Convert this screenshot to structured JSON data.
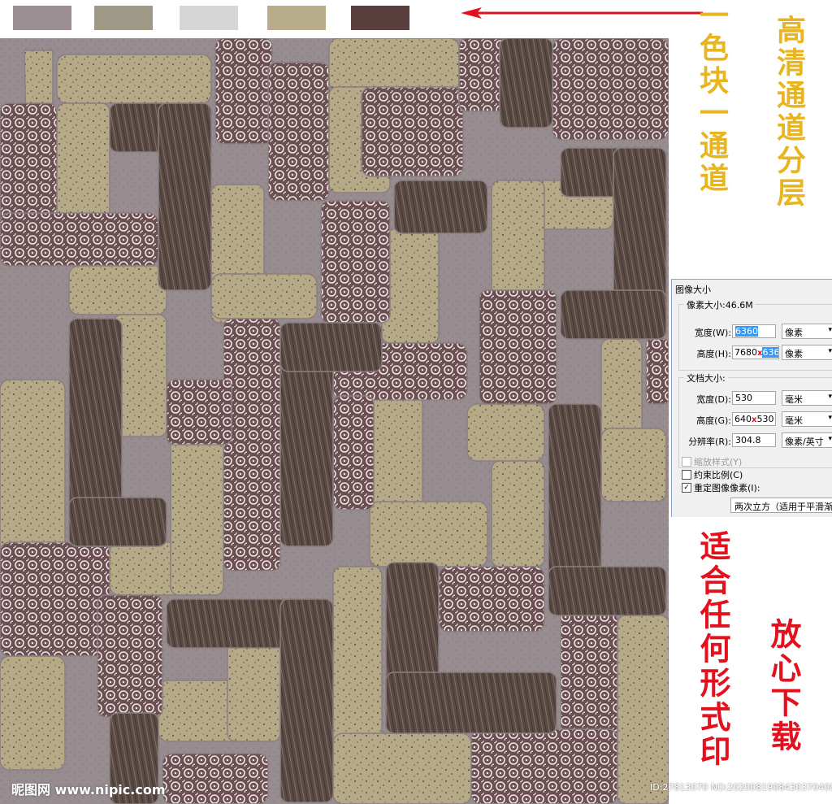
{
  "swatches": [
    {
      "name": "gray-mauve",
      "color": "#9c8f93"
    },
    {
      "name": "olive-gray",
      "color": "#9f9a87"
    },
    {
      "name": "light-gray",
      "color": "#d6d6d6"
    },
    {
      "name": "tan",
      "color": "#b8ad8a"
    },
    {
      "name": "dark-brown",
      "color": "#5b3e3e"
    }
  ],
  "annotations": {
    "channel_note": "一色块一通道",
    "hd_note": "高清通道分层",
    "print_note": "适合任何形式印",
    "download_note": "放心下载"
  },
  "dialog": {
    "title": "图像大小",
    "pixel_size_label": "像素大小:46.6M",
    "width_label": "宽度(W):",
    "width_value": "6360",
    "width_unit": "像素",
    "height_label": "高度(H):",
    "height_value_old": "7680",
    "height_value_new": "6360",
    "height_unit": "像素",
    "doc_size_label": "文档大小:",
    "doc_width_label": "宽度(D):",
    "doc_width_value": "530",
    "doc_width_unit": "毫米",
    "doc_height_label": "高度(G):",
    "doc_height_value_old": "640",
    "doc_height_value_new": "530",
    "doc_height_unit": "毫米",
    "resolution_label": "分辨率(R):",
    "resolution_value": "304.8",
    "resolution_unit": "像素/英寸",
    "scale_styles_label": "缩放样式(Y)",
    "constrain_label": "约束比例(C)",
    "resample_label": "重定图像像素(I):",
    "resample_method": "两次立方（适用于平滑渐变"
  },
  "watermark": {
    "logo": "昵图网 www.nipic.com",
    "id": "ID:27813070 NO:20200819084303704081"
  },
  "colors": {
    "background_mauve": "#978c90",
    "tan_block": "#b5a987",
    "dark_block": "#5a4a44",
    "flower_block": "#6b4f52",
    "gold_text": "#e8b51f",
    "red_text": "#e3101e"
  },
  "icons": {
    "arrow": "left-arrow",
    "mark": "red-x-mark",
    "chevron": "chevron-down-icon"
  }
}
